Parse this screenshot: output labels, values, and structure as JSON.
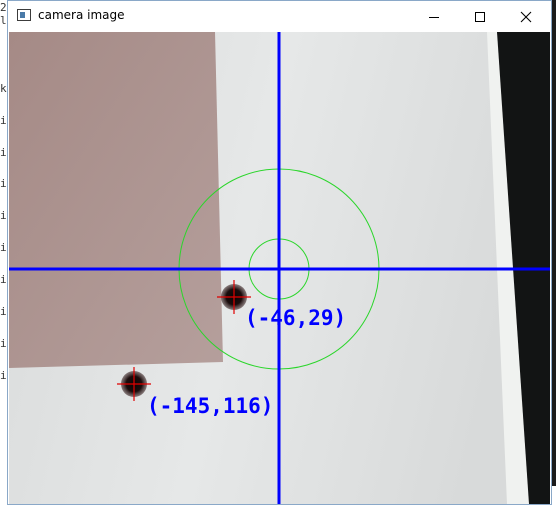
{
  "window": {
    "title": "camera image",
    "controls": [
      "minimize",
      "maximize",
      "close"
    ]
  },
  "console_chars": [
    "2",
    "l",
    "k",
    "i",
    "i",
    "i",
    "i",
    "i",
    "i",
    "i",
    "i",
    "i",
    "i"
  ],
  "overlay": {
    "crosshair_color": "#0000ff",
    "circle_color": "#2bd62b",
    "marker_color": "#e00000",
    "targets": [
      {
        "label": "(-46,29)"
      },
      {
        "label": "(-145,116)"
      }
    ]
  }
}
